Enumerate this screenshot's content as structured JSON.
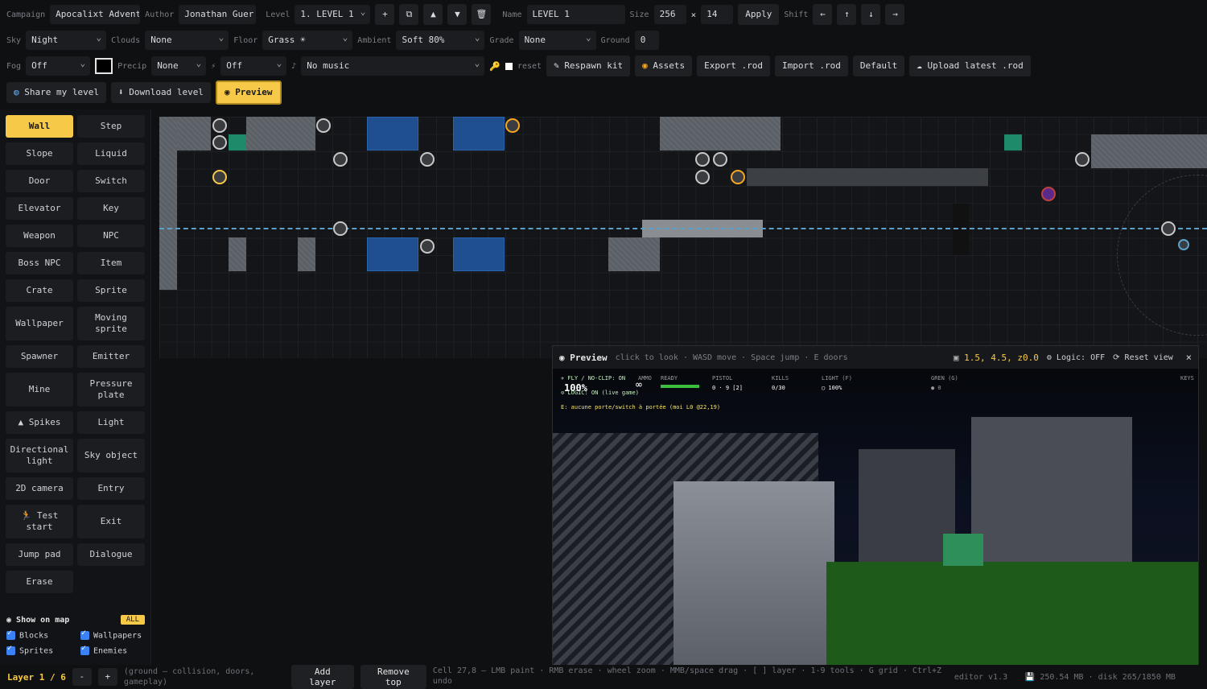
{
  "toolbar1": {
    "campaign_label": "Campaign",
    "campaign_value": "Apocalixt Adventure",
    "author_label": "Author",
    "author_value": "Jonathan Guerre",
    "level_label": "Level",
    "level_value": "1. LEVEL 1",
    "add": "+",
    "duplicate": "⧉",
    "up": "▲",
    "down": "▼",
    "delete": "🗑",
    "name_label": "Name",
    "name_value": "LEVEL 1",
    "size_label": "Size",
    "size_w": "256",
    "size_x": "×",
    "size_h": "14",
    "apply": "Apply",
    "shift_label": "Shift",
    "shift_left": "←",
    "shift_up": "↑",
    "shift_down": "↓",
    "shift_right": "→"
  },
  "toolbar2": {
    "sky_label": "Sky",
    "sky_value": "Night",
    "clouds_label": "Clouds",
    "clouds_value": "None",
    "floor_label": "Floor",
    "floor_value": "Grass ☀",
    "ambient_label": "Ambient",
    "ambient_value": "Soft 80%",
    "grade_label": "Grade",
    "grade_value": "None",
    "ground_label": "Ground",
    "ground_value": "0"
  },
  "toolbar3": {
    "fog_label": "Fog",
    "fog_value": "Off",
    "precip_label": "Precip",
    "precip_value": "None",
    "wind_icon": "⚡",
    "wind_value": "Off",
    "music_icon": "♪",
    "music_value": "No music",
    "key_icon": "🔑",
    "reset": "reset",
    "respawn": "Respawn kit",
    "assets": "Assets",
    "export": "Export .rod",
    "import": "Import .rod",
    "default": "Default",
    "upload": "Upload latest .rod"
  },
  "toolbar4": {
    "share": "Share my level",
    "download": "Download level",
    "preview": "Preview"
  },
  "tools": [
    {
      "label": "Wall",
      "active": true
    },
    {
      "label": "Step"
    },
    {
      "label": "Slope"
    },
    {
      "label": "Liquid"
    },
    {
      "label": "Door"
    },
    {
      "label": "Switch"
    },
    {
      "label": "Elevator"
    },
    {
      "label": "Key"
    },
    {
      "label": "Weapon"
    },
    {
      "label": "NPC"
    },
    {
      "label": "Boss NPC"
    },
    {
      "label": "Item"
    },
    {
      "label": "Crate"
    },
    {
      "label": "Sprite"
    },
    {
      "label": "Wallpaper"
    },
    {
      "label": "Moving sprite"
    },
    {
      "label": "Spawner"
    },
    {
      "label": "Emitter"
    },
    {
      "label": "Mine"
    },
    {
      "label": "Pressure plate"
    },
    {
      "label": "▲ Spikes"
    },
    {
      "label": "Light"
    },
    {
      "label": "Directional light"
    },
    {
      "label": "Sky object"
    },
    {
      "label": "2D camera"
    },
    {
      "label": "Entry"
    },
    {
      "label": "🏃 Test start"
    },
    {
      "label": "Exit"
    },
    {
      "label": "Jump pad"
    },
    {
      "label": "Dialogue"
    },
    {
      "label": "Erase"
    }
  ],
  "show_on_map": {
    "title": "Show on map",
    "all": "ALL",
    "items": [
      "Blocks",
      "Wallpapers",
      "Sprites",
      "Enemies"
    ]
  },
  "preview": {
    "title": "Preview",
    "hint": "click to look · WASD move · Space jump · E doors",
    "coords": "1.5, 4.5, z0.0",
    "logic": "Logic: OFF",
    "reset": "Reset view",
    "close": "×",
    "hud": {
      "fly": "✈ FLY / NO-CLIP: ON",
      "health": "100%",
      "logic": "⊙ LOGIC: ON (live game)",
      "ammo_label": "AMMO",
      "ammo": "∞",
      "ready": "READY",
      "pistol_label": "PISTOL",
      "pistol": "0 · 9 [2]",
      "kills_label": "KILLS",
      "kills": "0/30",
      "light_label": "LIGHT (F)",
      "light": "◯ 100%",
      "gren_label": "GREN (G)",
      "gren": "● 0",
      "keys_label": "KEYS",
      "msg": "E: aucune porte/switch à portée (moi L0 @22,19)"
    }
  },
  "status": {
    "layer": "Layer 1 / 6",
    "minus": "-",
    "plus": "+",
    "layer_desc": "(ground — collision, doors, gameplay)",
    "add_layer": "Add layer",
    "remove_top": "Remove top",
    "help": "Cell 27,8 — LMB paint · RMB erase · wheel zoom · MMB/space drag · [ ] layer · 1-9 tools · G grid · Ctrl+Z undo",
    "version": "editor v1.3",
    "memory": "💾 250.54 MB · disk 265/1850 MB"
  },
  "colors": {
    "accent": "#f7c948",
    "water": "#1f4f8f",
    "checkbox": "#3b82f6"
  }
}
